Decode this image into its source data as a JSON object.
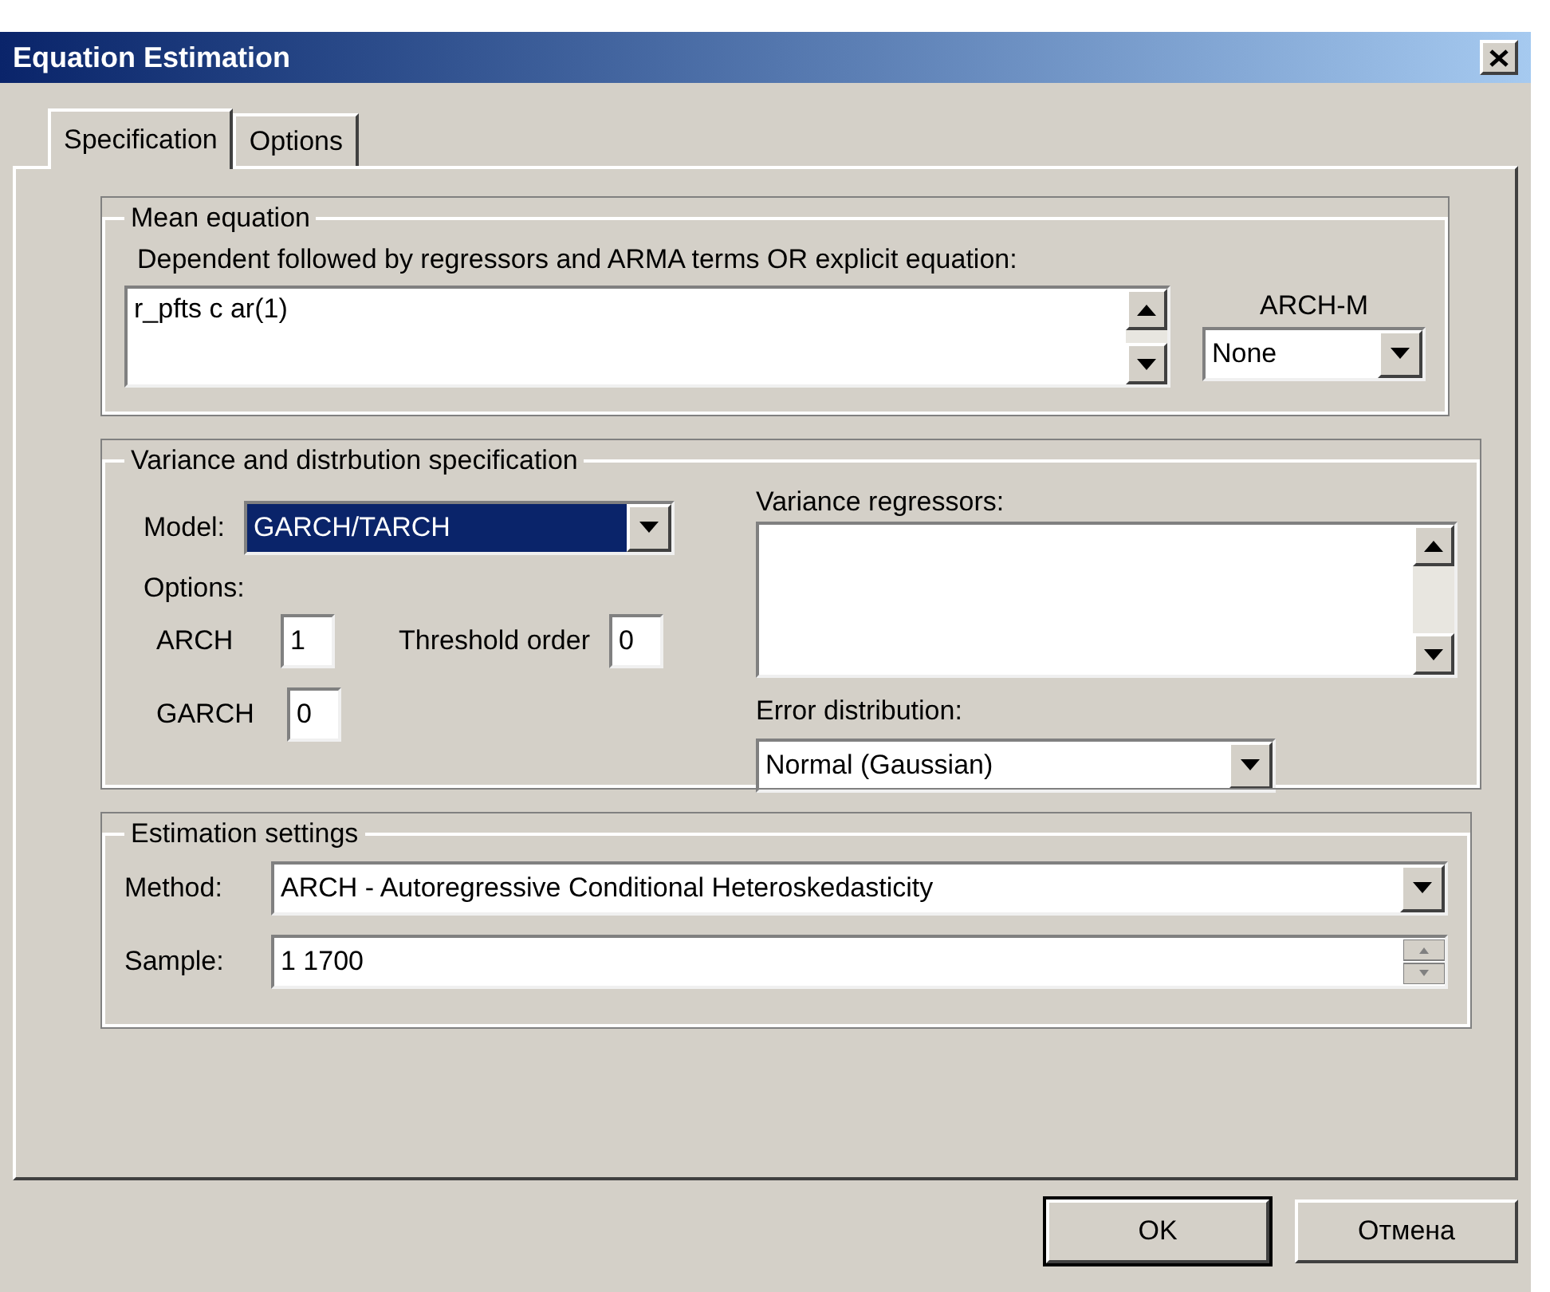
{
  "window": {
    "title": "Equation Estimation"
  },
  "tabs": [
    {
      "label": "Specification",
      "selected": true
    },
    {
      "label": "Options",
      "selected": false
    }
  ],
  "mean_equation": {
    "title": "Mean equation",
    "prompt": "Dependent followed by regressors and ARMA terms OR explicit equation:",
    "value": "r_pfts c ar(1)",
    "arch_m": {
      "label": "ARCH-M",
      "value": "None"
    }
  },
  "variance": {
    "title": "Variance and distrbution specification",
    "model": {
      "label": "Model:",
      "value": "GARCH/TARCH",
      "focused": true
    },
    "options_label": "Options:",
    "arch": {
      "label": "ARCH",
      "value": "1"
    },
    "threshold": {
      "label": "Threshold order",
      "value": "0"
    },
    "garch": {
      "label": "GARCH",
      "value": "0"
    },
    "variance_regressors": {
      "label": "Variance regressors:"
    },
    "error_distribution": {
      "label": "Error distribution:",
      "value": "Normal (Gaussian)"
    }
  },
  "estimation": {
    "title": "Estimation settings",
    "method": {
      "label": "Method:",
      "value": "ARCH  - Autoregressive Conditional Heteroskedasticity"
    },
    "sample": {
      "label": "Sample:",
      "value": "1 1700"
    }
  },
  "buttons": [
    {
      "label": "OK",
      "default": true
    },
    {
      "label": "Отмена",
      "default": false
    }
  ]
}
